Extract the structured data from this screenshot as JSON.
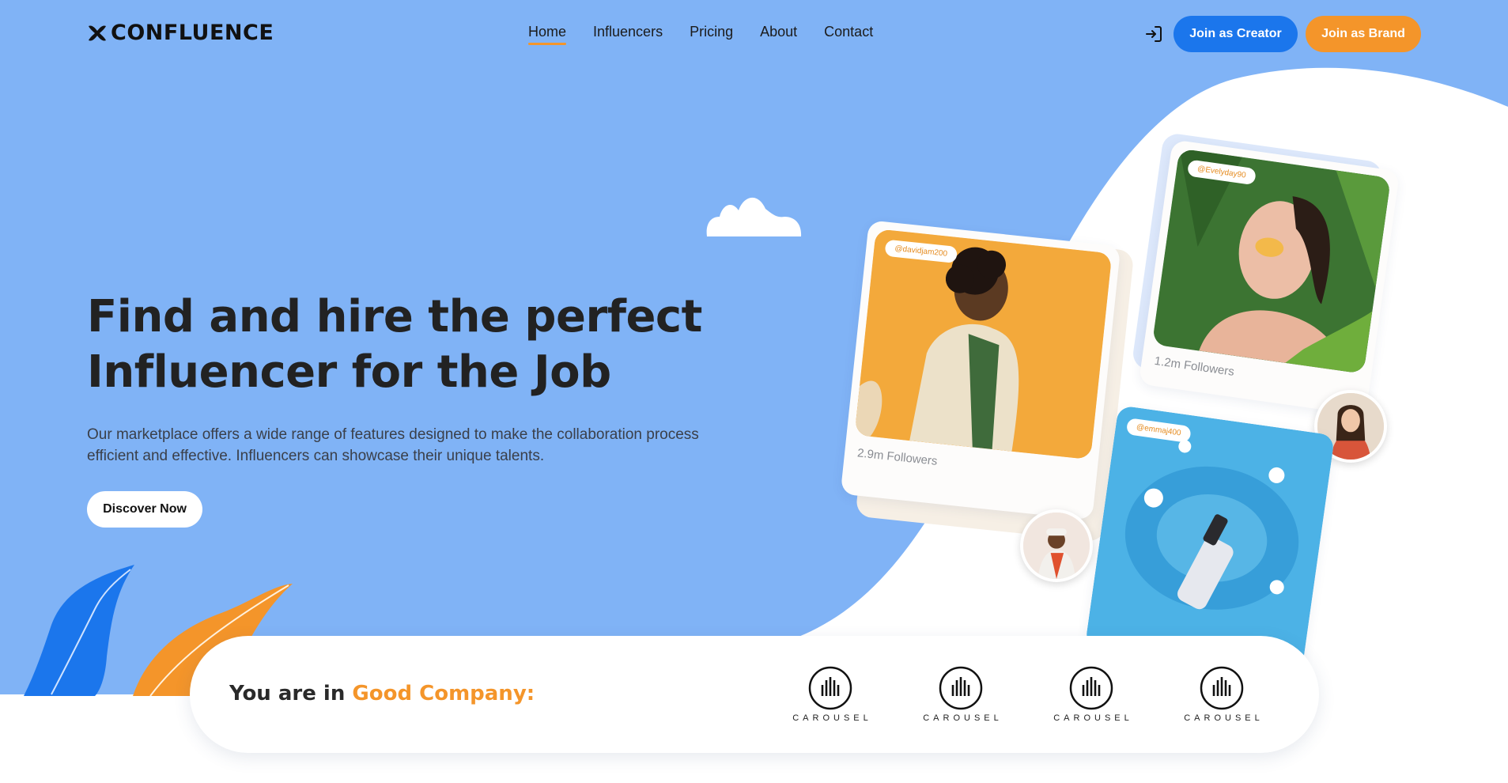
{
  "brand": {
    "name": "CONFLUENCE",
    "logo_icon": "confluence-x-icon"
  },
  "nav": {
    "items": [
      {
        "label": "Home",
        "active": true
      },
      {
        "label": "Influencers",
        "active": false
      },
      {
        "label": "Pricing",
        "active": false
      },
      {
        "label": "About",
        "active": false
      },
      {
        "label": "Contact",
        "active": false
      }
    ]
  },
  "header_actions": {
    "login_icon": "sign-in-icon",
    "join_creator_label": "Join as Creator",
    "join_brand_label": "Join as Brand"
  },
  "hero": {
    "headline_line1": "Find and hire the perfect",
    "headline_line2": "Influencer for the Job",
    "subcopy_line1": "Our marketplace offers a wide range of features designed to make the collaboration process",
    "subcopy_line2": "efficient and effective. Influencers can showcase their unique talents.",
    "cta_label": "Discover Now"
  },
  "influencer_cards": [
    {
      "handle": "@davidjam200",
      "followers": "2.9m Followers"
    },
    {
      "handle": "@Evelyday90",
      "followers": "1.2m Followers"
    },
    {
      "handle": "@emmaj400",
      "followers": ""
    }
  ],
  "companies": {
    "label_prefix": "You are in ",
    "label_accent": "Good Company:",
    "partners": [
      "CAROUSEL",
      "CAROUSEL",
      "CAROUSEL",
      "CAROUSEL"
    ]
  },
  "colors": {
    "hero_bg": "#80b3f6",
    "primary_blue": "#1b76ec",
    "accent_orange": "#f4952a",
    "text_dark": "#222222"
  }
}
